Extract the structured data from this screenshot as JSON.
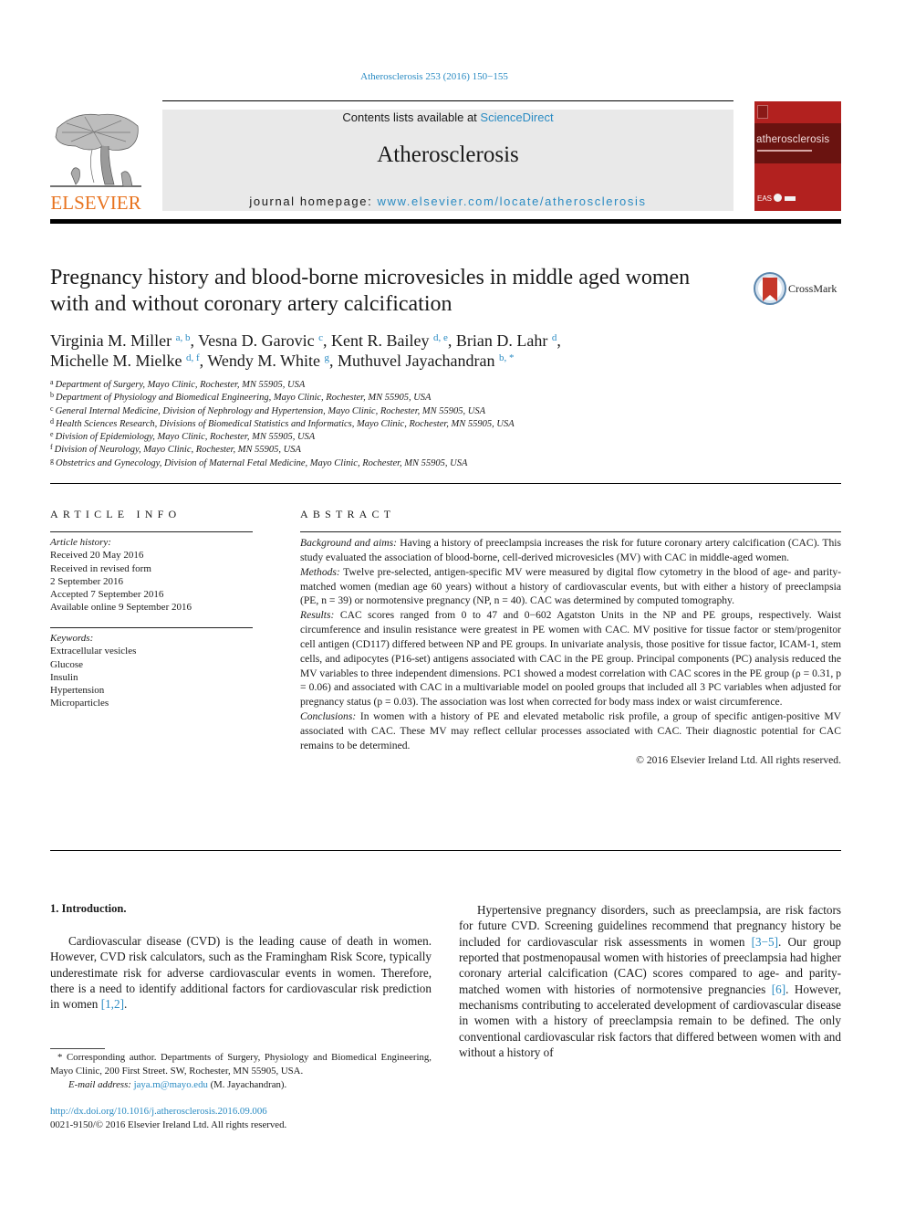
{
  "header": {
    "journal_reference": "Atherosclerosis 253 (2016) 150−155",
    "publisher_logo_text": "ELSEVIER",
    "contents_prefix": "Contents lists available at ",
    "contents_link": "ScienceDirect",
    "journal_title": "Atherosclerosis",
    "homepage_prefix": "journal homepage: ",
    "homepage_link": "www.elsevier.com/locate/atherosclerosis",
    "cover_title": "atherosclerosis",
    "cover_footer": "EAS",
    "crossmark_label": "CrossMark"
  },
  "article": {
    "title": "Pregnancy history and blood-borne microvesicles in middle aged women with and without coronary artery calcification",
    "authors": [
      {
        "name": "Virginia M. Miller",
        "aff": "a, b",
        "sep": ", "
      },
      {
        "name": "Vesna D. Garovic",
        "aff": "c",
        "sep": ", "
      },
      {
        "name": "Kent R. Bailey",
        "aff": "d, e",
        "sep": ", "
      },
      {
        "name": "Brian D. Lahr",
        "aff": "d",
        "sep": ","
      },
      {
        "name": "Michelle M. Mielke",
        "aff": "d, f",
        "sep": ", "
      },
      {
        "name": "Wendy M. White",
        "aff": "g",
        "sep": ", "
      },
      {
        "name": "Muthuvel Jayachandran",
        "aff": "b, *",
        "sep": ""
      }
    ],
    "affiliations": [
      {
        "key": "a",
        "text": "Department of Surgery, Mayo Clinic, Rochester, MN 55905, USA"
      },
      {
        "key": "b",
        "text": "Department of Physiology and Biomedical Engineering, Mayo Clinic, Rochester, MN 55905, USA"
      },
      {
        "key": "c",
        "text": "General Internal Medicine, Division of Nephrology and Hypertension, Mayo Clinic, Rochester, MN 55905, USA"
      },
      {
        "key": "d",
        "text": "Health Sciences Research, Divisions of Biomedical Statistics and Informatics, Mayo Clinic, Rochester, MN 55905, USA"
      },
      {
        "key": "e",
        "text": "Division of Epidemiology, Mayo Clinic, Rochester, MN 55905, USA"
      },
      {
        "key": "f",
        "text": "Division of Neurology, Mayo Clinic, Rochester, MN 55905, USA"
      },
      {
        "key": "g",
        "text": "Obstetrics and Gynecology, Division of Maternal Fetal Medicine, Mayo Clinic, Rochester, MN 55905, USA"
      }
    ]
  },
  "article_info": {
    "label": "ARTICLE INFO",
    "history_heading": "Article history:",
    "history": [
      "Received 20 May 2016",
      "Received in revised form",
      "2 September 2016",
      "Accepted 7 September 2016",
      "Available online 9 September 2016"
    ],
    "keywords_heading": "Keywords:",
    "keywords": [
      "Extracellular vesicles",
      "Glucose",
      "Insulin",
      "Hypertension",
      "Microparticles"
    ]
  },
  "abstract": {
    "label": "ABSTRACT",
    "sections": [
      {
        "label": "Background and aims:",
        "text": " Having a history of preeclampsia increases the risk for future coronary artery calcification (CAC). This study evaluated the association of blood-borne, cell-derived microvesicles (MV) with CAC in middle-aged women."
      },
      {
        "label": "Methods:",
        "text": " Twelve pre-selected, antigen-specific MV were measured by digital flow cytometry in the blood of age- and parity-matched women (median age 60 years) without a history of cardiovascular events, but with either a history of preeclampsia (PE, n = 39) or normotensive pregnancy (NP, n = 40). CAC was determined by computed tomography."
      },
      {
        "label": "Results:",
        "text": " CAC scores ranged from 0 to 47 and 0−602 Agatston Units in the NP and PE groups, respectively. Waist circumference and insulin resistance were greatest in PE women with CAC. MV positive for tissue factor or stem/progenitor cell antigen (CD117) differed between NP and PE groups. In univariate analysis, those positive for tissue factor, ICAM-1, stem cells, and adipocytes (P16-set) antigens associated with CAC in the PE group. Principal components (PC) analysis reduced the MV variables to three independent dimensions. PC1 showed a modest correlation with CAC scores in the PE group (ρ = 0.31, p = 0.06) and associated with CAC in a multivariable model on pooled groups that included all 3 PC variables when adjusted for pregnancy status (p = 0.03). The association was lost when corrected for body mass index or waist circumference."
      },
      {
        "label": "Conclusions:",
        "text": " In women with a history of PE and elevated metabolic risk profile, a group of specific antigen-positive MV associated with CAC. These MV may reflect cellular processes associated with CAC. Their diagnostic potential for CAC remains to be determined."
      }
    ],
    "copyright": "© 2016 Elsevier Ireland Ltd. All rights reserved."
  },
  "introduction": {
    "heading": "1.  Introduction.",
    "left_paragraph": {
      "text": "Cardiovascular disease (CVD) is the leading cause of death in women. However, CVD risk calculators, such as the Framingham Risk Score, typically underestimate risk for adverse cardiovascular events in women. Therefore, there is a need to identify additional factors for cardiovascular risk prediction in women ",
      "ref": "[1,2]",
      "end": "."
    },
    "right_paragraph": {
      "part1": "Hypertensive pregnancy disorders, such as preeclampsia, are risk factors for future CVD. Screening guidelines recommend that pregnancy history be included for cardiovascular risk assessments in women ",
      "ref1": "[3−5]",
      "part2": ". Our group reported that postmenopausal women with histories of preeclampsia had higher coronary arterial calcification (CAC) scores compared to age- and parity-matched women with histories of normotensive pregnancies ",
      "ref2": "[6]",
      "part3": ". However, mechanisms contributing to accelerated development of cardiovascular disease in women with a history of preeclampsia remain to be defined. The only conventional cardiovascular risk factors that differed between women with and without a history of"
    }
  },
  "footnotes": {
    "corresponding": "* Corresponding author. Departments of Surgery, Physiology and Biomedical Engineering, Mayo Clinic, 200 First Street. SW, Rochester, MN 55905, USA.",
    "email_label": "E-mail address:",
    "email": "jaya.m@mayo.edu",
    "email_suffix": " (M. Jayachandran).",
    "doi": "http://dx.doi.org/10.1016/j.atherosclerosis.2016.09.006",
    "issn": "0021-9150/© 2016 Elsevier Ireland Ltd. All rights reserved."
  }
}
